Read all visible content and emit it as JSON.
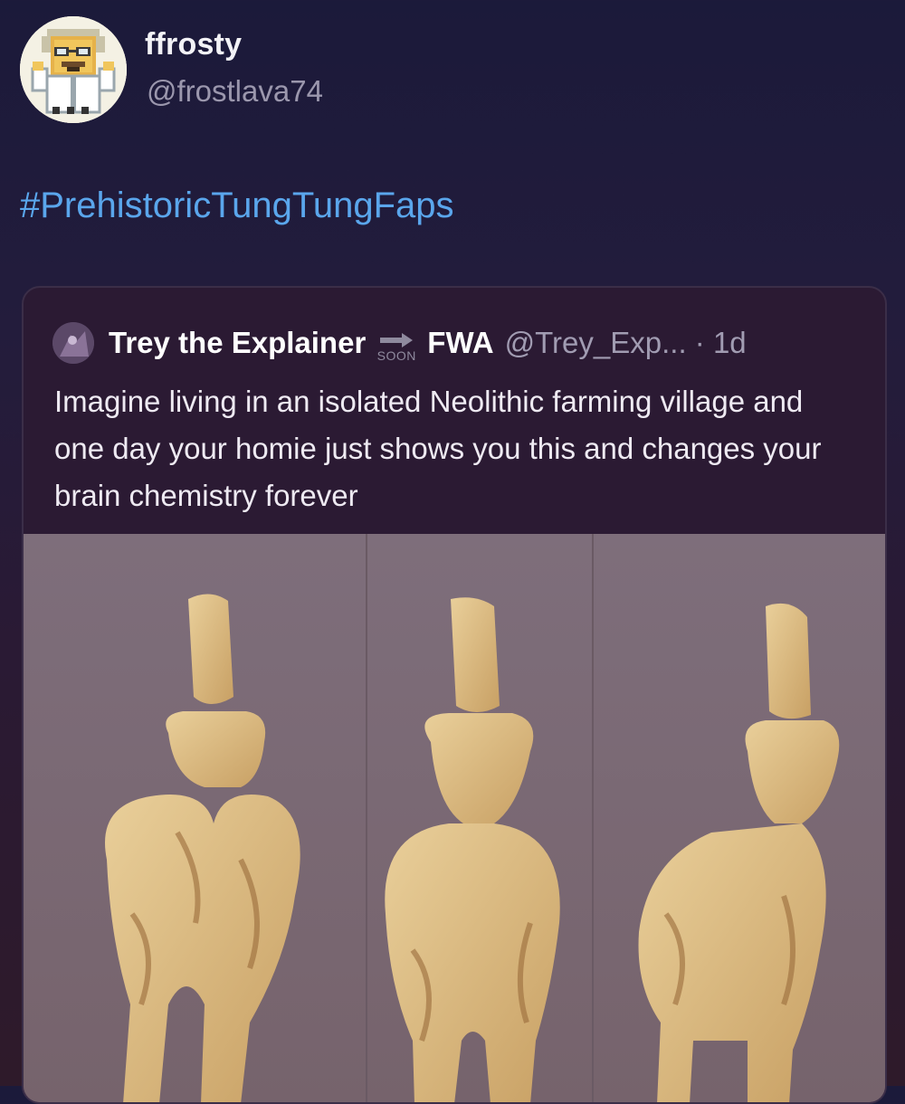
{
  "post": {
    "display_name": "ffrosty",
    "handle": "@frostlava74",
    "hashtag": "#PrehistoricTungTungFaps",
    "avatar_icon": "pixel-art-scientist-avatar"
  },
  "quoted_post": {
    "author_name": "Trey the Explainer",
    "badge_text": "SOON",
    "badge_icon": "arrow-right-icon",
    "author_name_suffix": "FWA",
    "meta": "@Trey_Exp... · 1d",
    "text": "Imagine living in an isolated Neolithic farming village and one day your homie just shows you this and changes your brain chemistry forever",
    "media_description_icon": "neolithic-figurine-photo"
  },
  "colors": {
    "hashtag": "#5aa6ec",
    "background_top": "#1b1a3a",
    "background_bottom": "#2e1a2a"
  }
}
